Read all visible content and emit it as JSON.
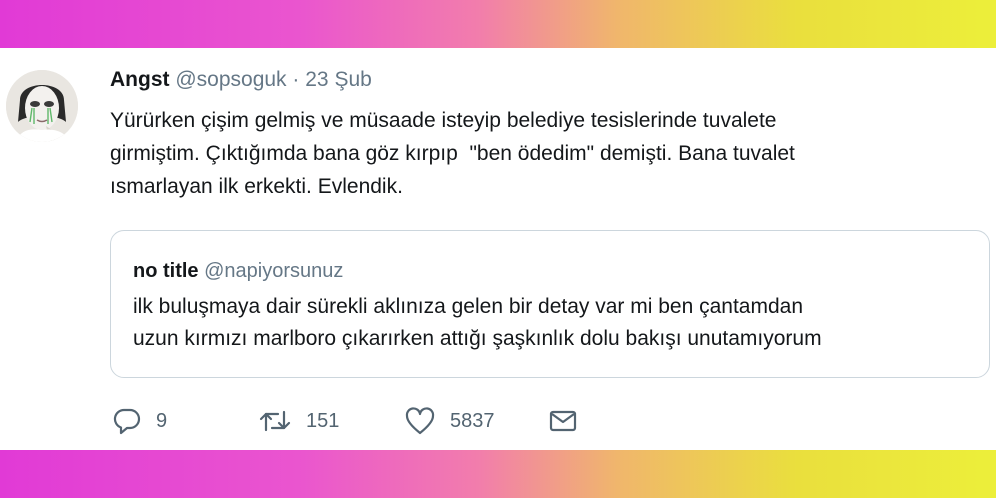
{
  "tweet": {
    "author_name": "Angst",
    "handle": "@sopsoguk",
    "separator": "·",
    "date": "23 Şub",
    "text_lines": [
      "Yürürken çişim gelmiş ve müsaade isteyip belediye tesislerinde tuvalete",
      "girmiştim. Çıktığımda bana göz kırpıp  \"ben ödedim\" demişti. Bana tuvalet",
      "ısmarlayan ilk erkekti. Evlendik."
    ]
  },
  "quoted_tweet": {
    "author_name": "no title",
    "handle": "@napiyorsunuz",
    "text_lines": [
      "ilk buluşmaya dair sürekli aklınıza gelen bir detay var mi ben çantamdan",
      "uzun kırmızı marlboro çıkarırken attığı şaşkınlık dolu bakışı unutamıyorum"
    ]
  },
  "actions": {
    "reply_count": "9",
    "retweet_count": "151",
    "like_count": "5837"
  },
  "icons": {
    "reply": "reply-icon",
    "retweet": "retweet-icon",
    "like": "heart-icon",
    "message": "envelope-icon"
  },
  "colors": {
    "text": "#14171a",
    "secondary": "#657786",
    "border": "#ccd6dd",
    "band_left": "#e13ad6",
    "band_right": "#ecef3a"
  }
}
